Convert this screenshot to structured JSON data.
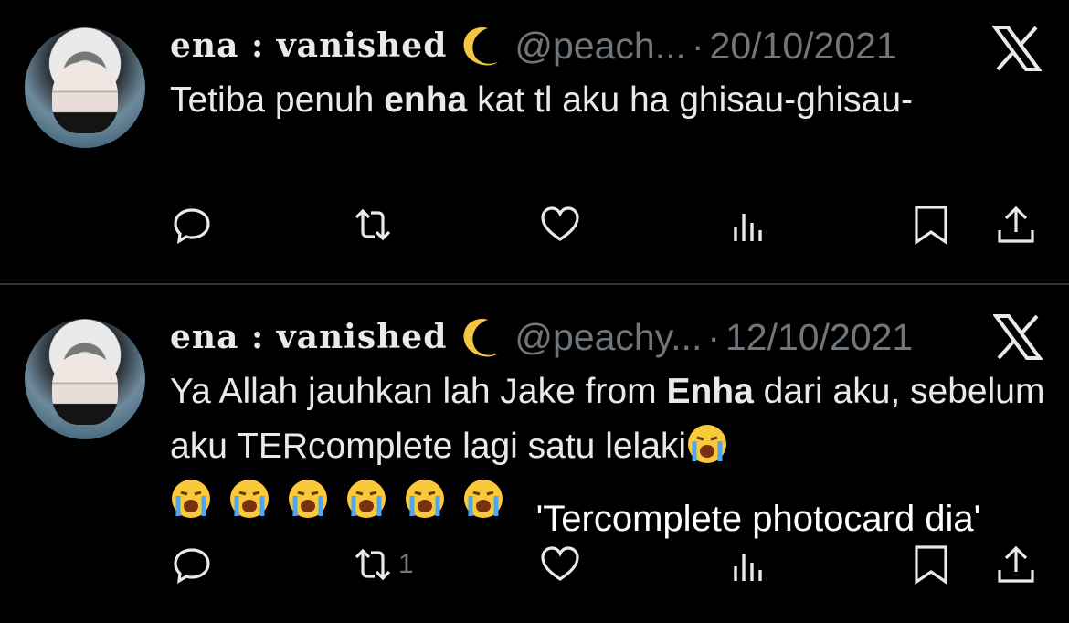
{
  "tweets": [
    {
      "display_name": "ena : vanished",
      "name_emoji": "crescent-moon",
      "handle": "@peach...",
      "separator": "·",
      "date": "20/10/2021",
      "text_before": "Tetiba penuh ",
      "text_bold": "enha",
      "text_after": " kat tl aku ha ghisau-ghisau-",
      "retweet_count": ""
    },
    {
      "display_name": "ena : vanished",
      "name_emoji": "crescent-moon",
      "handle": "@peachy...",
      "separator": "·",
      "date": "12/10/2021",
      "text_before": "Ya Allah jauhkan lah Jake from ",
      "text_bold": "Enha",
      "text_after": " dari aku, sebelum aku TERcomplete lagi satu lelaki",
      "emoji": "loudly-crying-face",
      "emoji_count_after": 6,
      "retweet_count": "1"
    }
  ],
  "caption": "'Tercomplete photocard dia'",
  "colors": {
    "background": "#000000",
    "text": "#e7e9ea",
    "muted": "#71767b",
    "divider": "#2f3336"
  },
  "icons": [
    "reply-icon",
    "retweet-icon",
    "like-icon",
    "views-icon",
    "bookmark-icon",
    "share-icon",
    "x-logo-icon"
  ]
}
